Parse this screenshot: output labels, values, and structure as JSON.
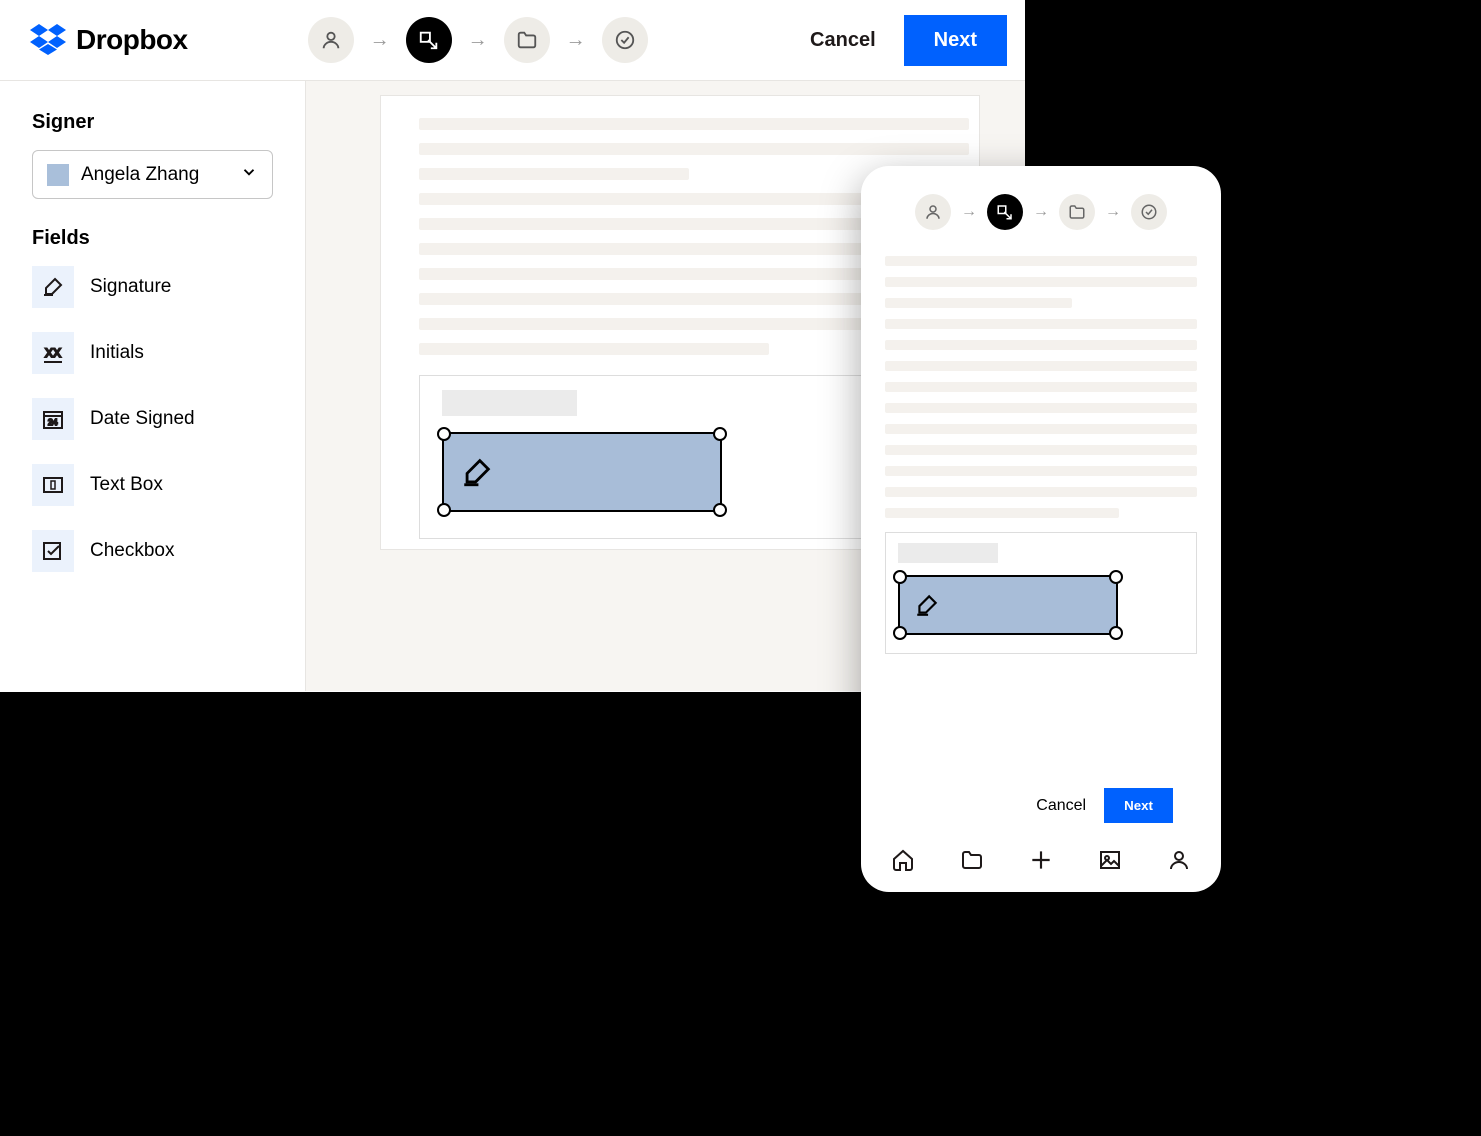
{
  "brand": {
    "name": "Dropbox"
  },
  "header": {
    "cancel": "Cancel",
    "next": "Next"
  },
  "sidebar": {
    "signer_heading": "Signer",
    "signer_name": "Angela Zhang",
    "fields_heading": "Fields",
    "fields": [
      {
        "key": "signature",
        "label": "Signature"
      },
      {
        "key": "initials",
        "label": "Initials"
      },
      {
        "key": "date",
        "label": "Date Signed"
      },
      {
        "key": "textbox",
        "label": "Text Box"
      },
      {
        "key": "checkbox",
        "label": "Checkbox"
      }
    ]
  },
  "mobile": {
    "cancel": "Cancel",
    "next": "Next"
  }
}
